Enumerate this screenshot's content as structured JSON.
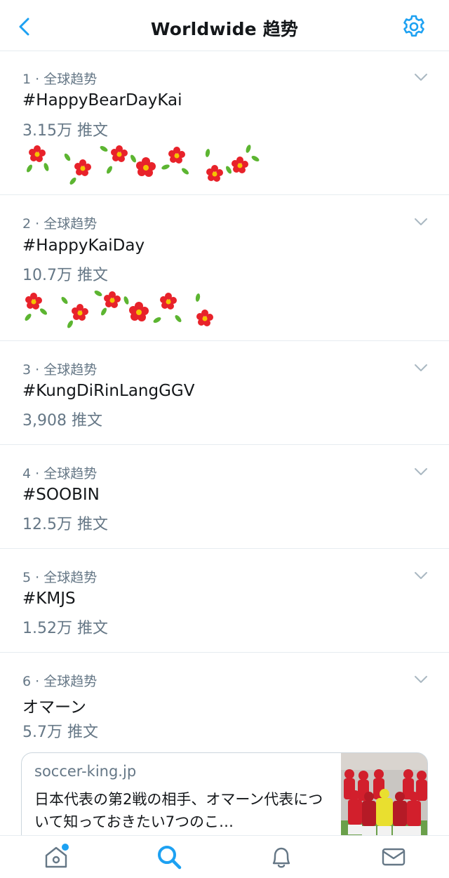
{
  "header": {
    "title": "Worldwide 趋势",
    "back_icon": "chevron-left-icon",
    "settings_icon": "gear-icon"
  },
  "colors": {
    "accent": "#1da1f2",
    "secondary_text": "#657786",
    "primary_text": "#14171a",
    "divider": "#e6ecf0",
    "flower_red": "#e8222a",
    "flower_center": "#f5c400",
    "leaf_green": "#5cb531"
  },
  "trends": [
    {
      "meta": "1 · 全球趋势",
      "name": "#HappyBearDayKai",
      "count": "3.15万 推文",
      "has_flowers": true
    },
    {
      "meta": "2 · 全球趋势",
      "name": "#HappyKaiDay",
      "count": "10.7万 推文",
      "has_flowers": true
    },
    {
      "meta": "3 · 全球趋势",
      "name": "#KungDiRinLangGGV",
      "count": "3,908 推文"
    },
    {
      "meta": "4 · 全球趋势",
      "name": "#SOOBIN",
      "count": "12.5万 推文"
    },
    {
      "meta": "5 · 全球趋势",
      "name": "#KMJS",
      "count": "1.52万 推文"
    },
    {
      "meta": "6 · 全球趋势",
      "name": "オマーン",
      "count": "5.7万 推文"
    }
  ],
  "card": {
    "domain": "soccer-king.jp",
    "title": "日本代表の第2戦の相手、オマーン代表について知っておきたい7つのこ…"
  },
  "tabbar": {
    "items": [
      {
        "icon": "home-icon",
        "has_notification_dot": true
      },
      {
        "icon": "search-icon",
        "active": true
      },
      {
        "icon": "bell-icon"
      },
      {
        "icon": "mail-icon"
      }
    ]
  }
}
